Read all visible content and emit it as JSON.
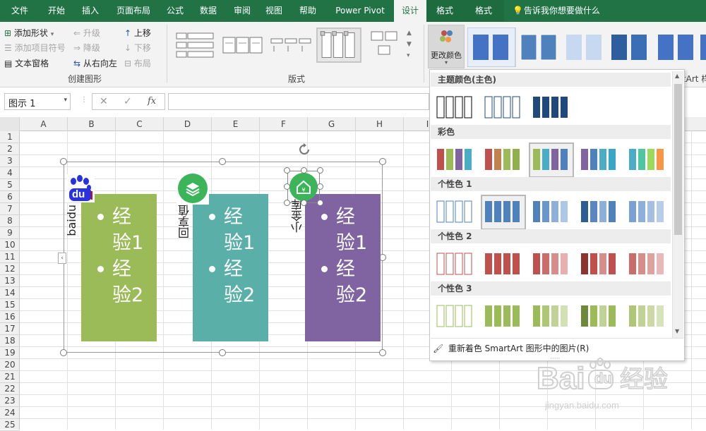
{
  "tabs": {
    "file": "文件",
    "home": "开始",
    "insert": "插入",
    "page_layout": "页面布局",
    "formulas": "公式",
    "data": "数据",
    "review": "审阅",
    "view": "视图",
    "help": "帮助",
    "power_pivot": "Power Pivot",
    "design": "设计",
    "format1": "格式",
    "format2": "格式",
    "tell_me": "告诉我你想要做什么"
  },
  "ribbon": {
    "create_graphic": {
      "add_shape": "添加形状",
      "add_bullet": "添加项目符号",
      "text_pane": "文本窗格",
      "promote": "升级",
      "demote": "降级",
      "right_to_left": "从右向左",
      "move_up": "上移",
      "move_down": "下移",
      "layout": "布局",
      "label": "创建图形"
    },
    "layouts_label": "版式",
    "change_colors": "更改颜色",
    "styles_label_partial": "rtArt 样"
  },
  "formula_bar": {
    "name_box": "图示 1",
    "fx": "fx",
    "cancel": "✕",
    "enter": "✓"
  },
  "sheet": {
    "columns": [
      "A",
      "B",
      "C",
      "D",
      "E",
      "F",
      "G",
      "H",
      "I"
    ],
    "rows": [
      "1",
      "2",
      "3",
      "4",
      "5",
      "6",
      "7",
      "8",
      "9",
      "10",
      "11",
      "12",
      "13",
      "14",
      "15",
      "16",
      "17",
      "18",
      "19",
      "20",
      "21",
      "22",
      "23",
      "24",
      "25"
    ]
  },
  "smartart": {
    "columns": [
      {
        "label": "baidu",
        "color": "#9bbb59",
        "bullet1a": "经",
        "bullet1b": "验1",
        "bullet2a": "经",
        "bullet2b": "验2"
      },
      {
        "label": "回享值",
        "color": "#4bacc6",
        "bullet1a": "经",
        "bullet1b": "验1",
        "bullet2a": "经",
        "bullet2b": "验2"
      },
      {
        "label": "小金库",
        "color": "#8064a2",
        "bullet1a": "经",
        "bullet1b": "验1",
        "bullet2a": "经",
        "bullet2b": "验2"
      }
    ],
    "logo_text": "du"
  },
  "color_menu": {
    "sections": [
      "主题颜色(主色)",
      "彩色",
      "个性色 1",
      "个性色 2",
      "个性色 3"
    ],
    "recolor": "重新着色 SmartArt 图形中的图片(R)",
    "recolor_underlined": "R"
  },
  "watermark": {
    "main": "Bai",
    "paw": "du",
    "suffix": "经验",
    "url": "jingyan.baidu.com"
  },
  "colors": {
    "excel_green": "#217346",
    "ribbon_bg": "#f3f3f3",
    "accent1": "#4f81bd",
    "accent2": "#c0504d",
    "accent3": "#9bbb59",
    "accent4": "#8064a2",
    "accent5": "#4bacc6",
    "accent6": "#f79646"
  }
}
